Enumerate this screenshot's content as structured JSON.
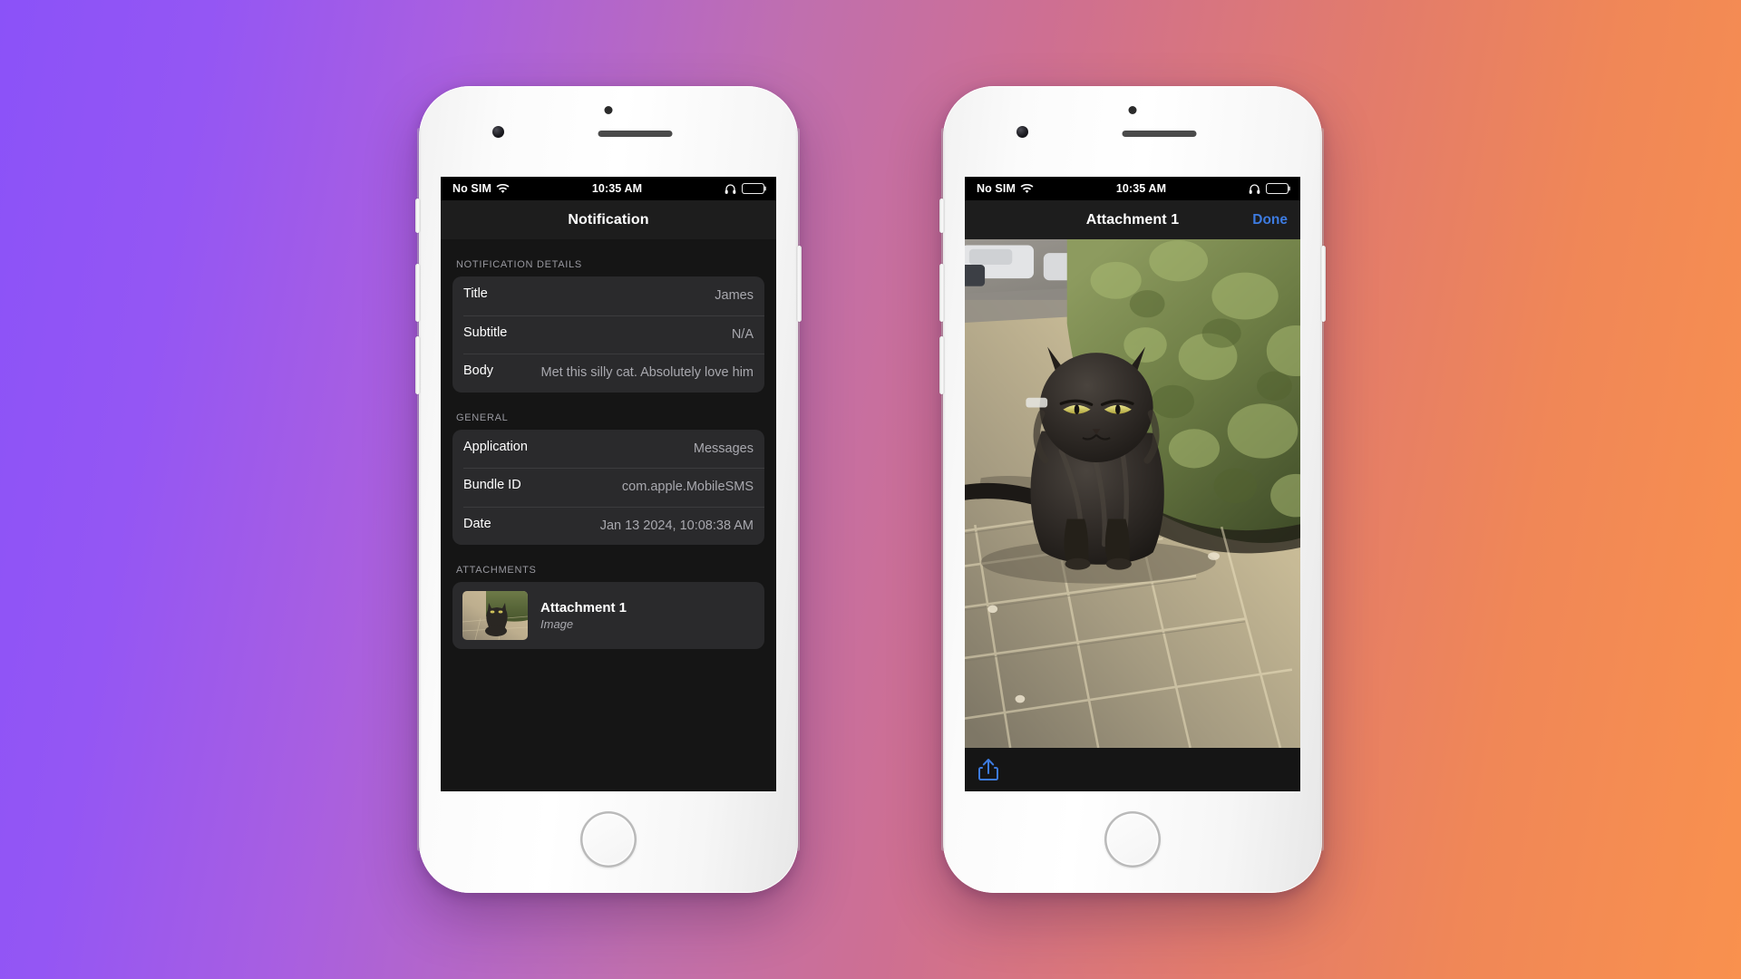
{
  "background": {
    "gradient_from": "#8B52F8",
    "gradient_mid": "#C06FAE",
    "gradient_to": "#F9914E"
  },
  "theme": {
    "accent_blue": "#3d7be0",
    "screen_bg": "#151515",
    "cell_bg": "#2a2a2c",
    "nav_bg": "#1d1d1d",
    "label_color": "#ffffff",
    "value_color": "#a8a8ae",
    "section_header_color": "#98989f"
  },
  "status_bar": {
    "carrier": "No SIM",
    "wifi_icon": "wifi-icon",
    "time": "10:35 AM",
    "headphone_icon": "headphone-icon",
    "battery_icon": "battery-icon"
  },
  "left_phone": {
    "nav": {
      "title": "Notification"
    },
    "sections": [
      {
        "header": "NOTIFICATION DETAILS",
        "rows": [
          {
            "label": "Title",
            "value": "James"
          },
          {
            "label": "Subtitle",
            "value": "N/A"
          },
          {
            "label": "Body",
            "value": "Met this silly cat. Absolutely love him"
          }
        ]
      },
      {
        "header": "GENERAL",
        "rows": [
          {
            "label": "Application",
            "value": "Messages"
          },
          {
            "label": "Bundle ID",
            "value": "com.apple.MobileSMS"
          },
          {
            "label": "Date",
            "value": "Jan 13 2024, 10:08:38 AM"
          }
        ]
      }
    ],
    "attachments": {
      "header": "ATTACHMENTS",
      "items": [
        {
          "title": "Attachment 1",
          "subtitle": "Image",
          "thumbnail_icon": "cat-photo-thumbnail"
        }
      ]
    }
  },
  "right_phone": {
    "nav": {
      "title": "Attachment 1",
      "action_label": "Done"
    },
    "image": {
      "alt": "cat-photo",
      "description": "Black fluffy cat sitting on paving stones beside green shrubs"
    },
    "toolbar": {
      "share_icon": "share-icon"
    }
  }
}
